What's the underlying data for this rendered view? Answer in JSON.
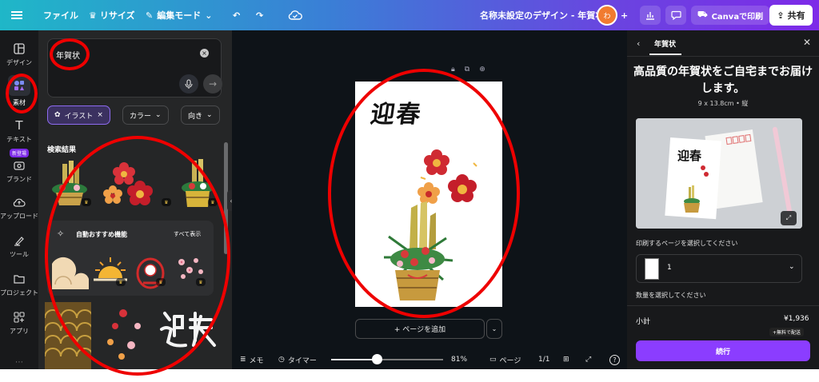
{
  "topbar": {
    "file_label": "ファイル",
    "resize_label": "リサイズ",
    "edit_mode_label": "編集モード",
    "doc_title": "名称未設定のデザイン - 年賀状",
    "print_label": "Canvaで印刷",
    "share_label": "共有",
    "avatar_text": "わ"
  },
  "rail": {
    "items": [
      {
        "label": "デザイン",
        "icon": "layout-icon"
      },
      {
        "label": "素材",
        "icon": "elements-icon"
      },
      {
        "label": "テキスト",
        "icon": "text-icon"
      },
      {
        "label": "ブランド",
        "icon": "brand-icon"
      },
      {
        "label": "アップロード",
        "icon": "upload-icon"
      },
      {
        "label": "ツール",
        "icon": "draw-icon"
      },
      {
        "label": "プロジェクト",
        "icon": "folder-icon"
      },
      {
        "label": "アプリ",
        "icon": "apps-icon"
      }
    ],
    "new_badge": "新登場"
  },
  "panel": {
    "search_value": "年賀状",
    "chips": [
      "イラスト",
      "カラー",
      "向き"
    ],
    "results_label": "検索結果",
    "reco_title": "自動おすすめ機能",
    "reco_all": "すべて表示"
  },
  "canvas": {
    "page_heading": "迎春",
    "add_page_label": "+ ページを追加"
  },
  "bottombar": {
    "memo_label": "メモ",
    "timer_label": "タイマー",
    "zoom_label": "81%",
    "zoom_value": 0.81,
    "pages_label": "ページ",
    "page_count": "1/1"
  },
  "right_panel": {
    "tab_label": "年賀状",
    "title": "高品質の年賀状をご自宅までお届けします。",
    "subtitle": "9 x 13.8cm • 縦",
    "photo_heading": "迎春",
    "select_page_label": "印刷するページを選択してください",
    "selected_page": "1",
    "quantity_label": "数量を選択してください",
    "subtotal_label": "小計",
    "price": "¥1,936",
    "shipping_label": "+無料で配送",
    "continue_label": "続行"
  },
  "colors": {
    "accent": "#8b3dff",
    "annotation": "#ee0000",
    "topbar_gradient_start": "#1fb7c8",
    "topbar_gradient_end": "#7d2ae8"
  }
}
